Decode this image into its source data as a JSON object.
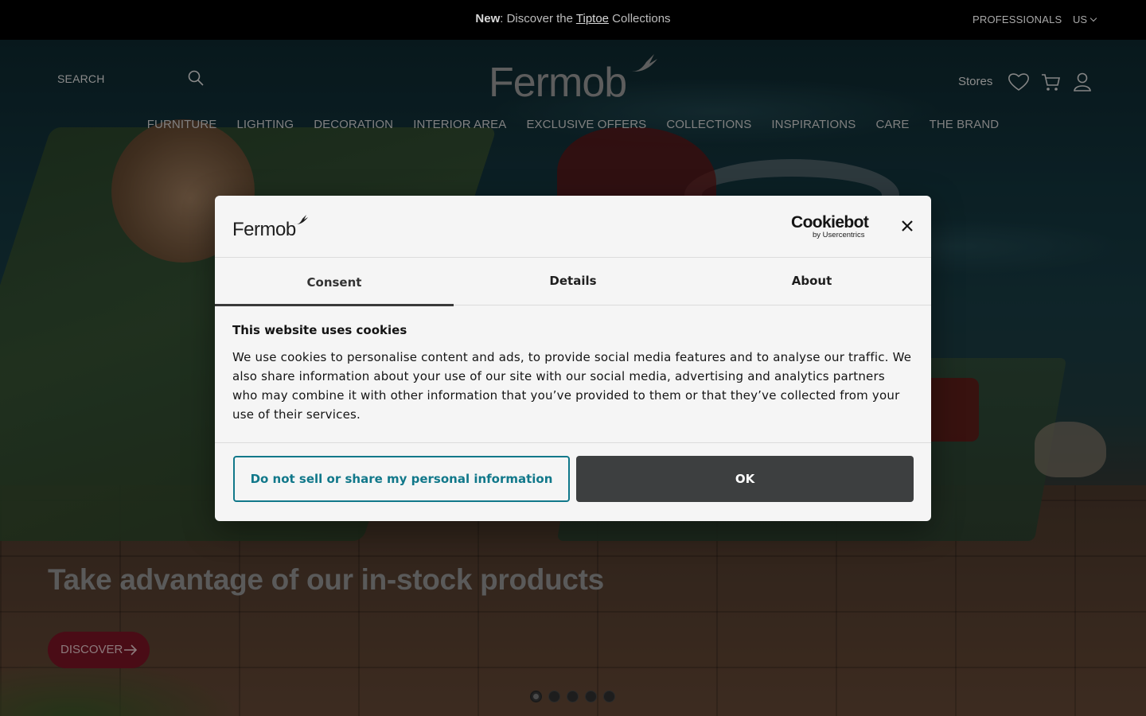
{
  "topbar": {
    "announce_new": "New",
    "announce_pre": ": Discover the ",
    "announce_link": "Tiptoe",
    "announce_post": " Collections",
    "professionals": "PROFESSIONALS",
    "locale": "US"
  },
  "header": {
    "search_placeholder": "SEARCH",
    "logo_text": "Fermob",
    "stores": "Stores",
    "icons": [
      "search-icon",
      "heart-icon",
      "cart-icon",
      "user-icon"
    ]
  },
  "nav": {
    "items": [
      "FURNITURE",
      "LIGHTING",
      "DECORATION",
      "INTERIOR AREA",
      "EXCLUSIVE OFFERS",
      "COLLECTIONS",
      "INSPIRATIONS",
      "CARE",
      "THE BRAND"
    ]
  },
  "hero": {
    "title": "Take advantage of our in-stock products",
    "cta": "DISCOVER",
    "slides": 5,
    "active_slide": 1
  },
  "cookie_dialog": {
    "brand_logo": "Fermob",
    "provider_name": "Cookiebot",
    "provider_sub": "by Usercentrics",
    "tabs": [
      "Consent",
      "Details",
      "About"
    ],
    "active_tab": "Consent",
    "heading": "This website uses cookies",
    "text": "We use cookies to personalise content and ads, to provide social media features and to analyse our traffic. We also share information about your use of our site with our social media, advertising and analytics partners who may combine it with other information that you’ve provided to them or that they’ve collected from your use of their services.",
    "btn_sell": "Do not sell or share my personal information",
    "btn_ok": "OK"
  },
  "colors": {
    "accent_teal": "#11788a",
    "ok_button": "#3d3f40",
    "cta_red": "#4a0c16"
  }
}
